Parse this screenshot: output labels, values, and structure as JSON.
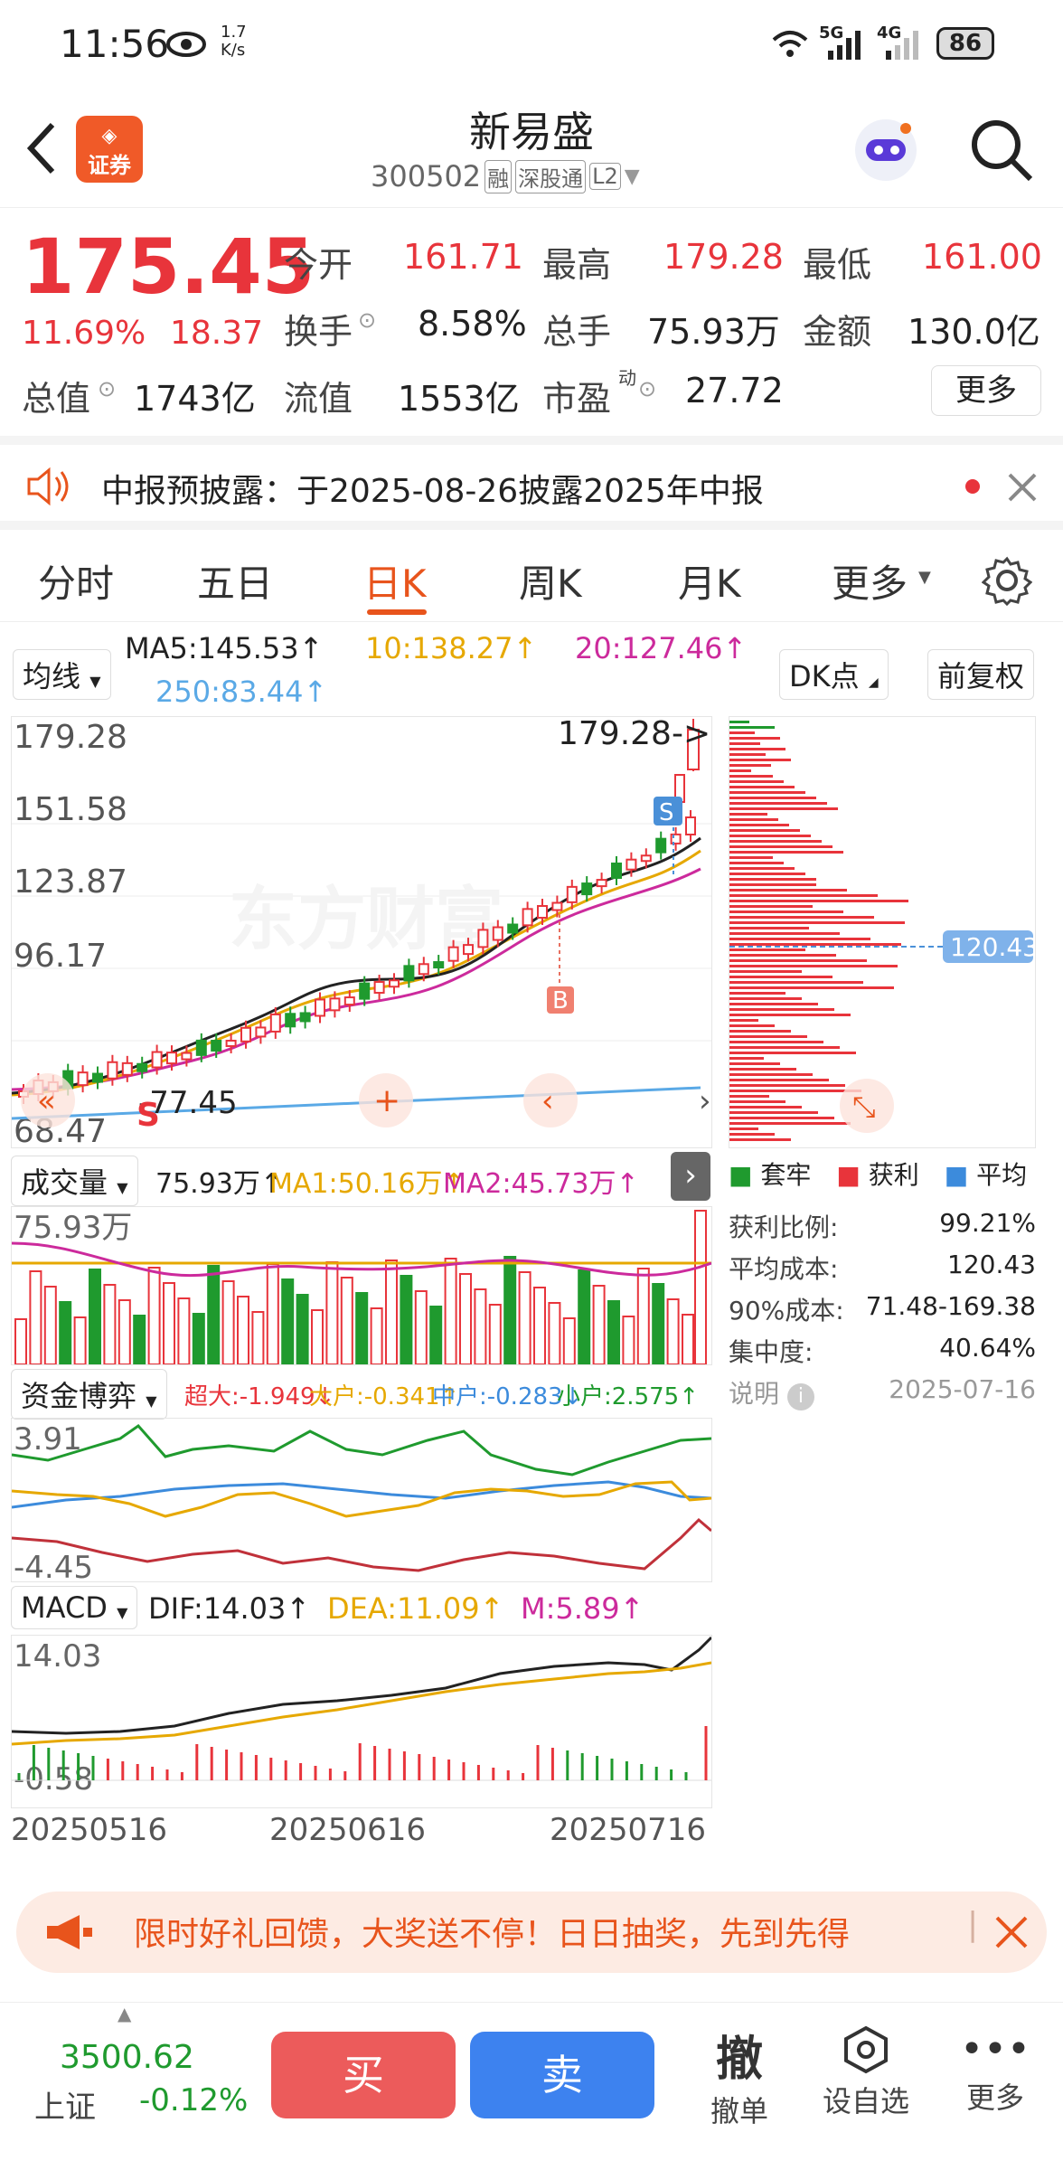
{
  "status_bar": {
    "time": "11:56",
    "speed": "1.7\nK/s",
    "net1": "5G",
    "net2": "4G",
    "battery": "86"
  },
  "header": {
    "title": "新易盛",
    "code": "300502",
    "tag_rong": "融",
    "tag_sgt": "深股通",
    "tag_l2": "L2",
    "badge": "证券"
  },
  "quote": {
    "price": "175.45",
    "change_pct": "11.69%",
    "change": "18.37",
    "open_label": "今开",
    "open": "161.71",
    "high_label": "最高",
    "high": "179.28",
    "low_label": "最低",
    "low": "161.00",
    "turnover_label": "换手",
    "turnover": "8.58%",
    "volume_label": "总手",
    "volume": "75.93万",
    "amount_label": "金额",
    "amount": "130.0亿",
    "mktcap_label": "总值",
    "mktcap": "1743亿",
    "float_label": "流值",
    "float": "1553亿",
    "pe_label": "市盈",
    "pe_sup": "动",
    "pe": "27.72",
    "more": "更多"
  },
  "notice": {
    "text": "中报预披露：于2025-08-26披露2025年中报"
  },
  "tabs": [
    "分时",
    "五日",
    "日K",
    "周K",
    "月K",
    "更多"
  ],
  "ma": {
    "selector": "均线",
    "ma5": "MA5:145.53↑",
    "ma10": "10:138.27↑",
    "ma20": "20:127.46↑",
    "ma250": "250:83.44↑",
    "dk": "DK点",
    "adjust": "前复权"
  },
  "kline": {
    "y_labels": [
      "179.28",
      "151.58",
      "123.87",
      "96.17",
      "68.47"
    ],
    "high_marker": "179.28->",
    "low_marker": "-77.45",
    "sell_tag": "S",
    "buy_tag": "B",
    "s_tag": "S",
    "watermark": "东方财富"
  },
  "chips": {
    "avg_cost_marker": "120.43",
    "legend": [
      "套牢",
      "获利",
      "平均"
    ],
    "stats": [
      {
        "label": "获利比例:",
        "value": "99.21%"
      },
      {
        "label": "平均成本:",
        "value": "120.43"
      },
      {
        "label": "90%成本:",
        "value": "71.48-169.38"
      },
      {
        "label": "集中度:",
        "value": "40.64%"
      }
    ],
    "note": "说明",
    "date": "2025-07-16"
  },
  "volume": {
    "selector": "成交量",
    "value": "75.93万↑",
    "ma1": "MA1:50.16万↑",
    "ma2": "MA2:45.73万↑",
    "y_top": "75.93万"
  },
  "fund": {
    "selector": "资金博弈",
    "super": "超大:-1.949↓",
    "big": "大户:-0.341↑",
    "mid": "中户:-0.283↓",
    "small": "小户:2.575↑",
    "y_top": "3.91",
    "y_bottom": "-4.45"
  },
  "macd": {
    "selector": "MACD",
    "dif": "DIF:14.03↑",
    "dea": "DEA:11.09↑",
    "m": "M:5.89↑",
    "y_top": "14.03",
    "y_bottom": "-0.58"
  },
  "dates": [
    "20250516",
    "20250616",
    "20250716"
  ],
  "promo": {
    "text": "限时好礼回馈，大奖送不停！日日抽奖，先到先得"
  },
  "bottom": {
    "index_value": "3500.62",
    "index_name": "上证",
    "index_change": "-0.12%",
    "buy": "买",
    "sell": "卖",
    "cancel_icon": "撤",
    "cancel": "撤单",
    "watch": "设自选",
    "more": "更多"
  },
  "colors": {
    "up": "#e8343b",
    "down": "#1f9a2e",
    "accent": "#e8541c",
    "ma5": "#222222",
    "ma10": "#e6a800",
    "ma20": "#cc2a9c",
    "ma250": "#5aa9e6"
  }
}
